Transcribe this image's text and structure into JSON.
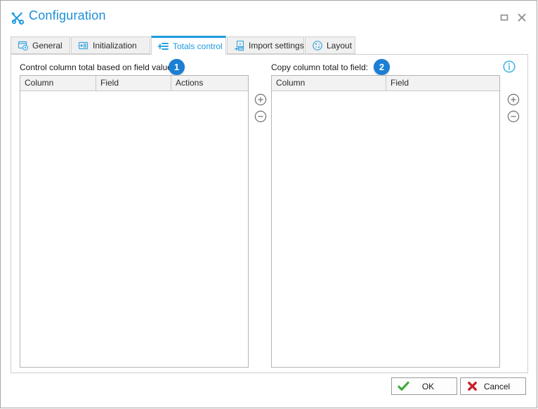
{
  "window": {
    "title": "Configuration",
    "title_icon": "tools-icon",
    "maximize_label": "Maximize",
    "close_label": "Close"
  },
  "tabs": [
    {
      "label": "General",
      "icon": "form-gear-icon",
      "active": false
    },
    {
      "label": "Initialization",
      "icon": "form-list-icon",
      "active": false
    },
    {
      "label": "Totals control",
      "icon": "plus-lines-icon",
      "active": true
    },
    {
      "label": "Import settings",
      "icon": "excel-import-icon",
      "active": false
    },
    {
      "label": "Layout",
      "icon": "palette-icon",
      "active": false
    }
  ],
  "left_panel": {
    "label": "Control column total based on field value:",
    "badge": "1",
    "columns": [
      "Column",
      "Field",
      "Actions"
    ],
    "rows": [],
    "add_button": "add-row-button",
    "remove_button": "remove-row-button"
  },
  "right_panel": {
    "label": "Copy column total to field:",
    "badge": "2",
    "columns": [
      "Column",
      "Field"
    ],
    "rows": [],
    "add_button": "add-row-button",
    "remove_button": "remove-row-button",
    "info_icon": "info-icon"
  },
  "footer": {
    "ok_label": "OK",
    "cancel_label": "Cancel"
  },
  "colors": {
    "accent": "#1c9ae0",
    "title": "#1c8fd6",
    "badge": "#1b7fd4",
    "ok_check": "#3ea93e",
    "cancel_cross": "#cc2027",
    "window_border": "#a6a6a6",
    "grid_border": "#b4b4b4",
    "header_bg": "#f2f2f2"
  }
}
